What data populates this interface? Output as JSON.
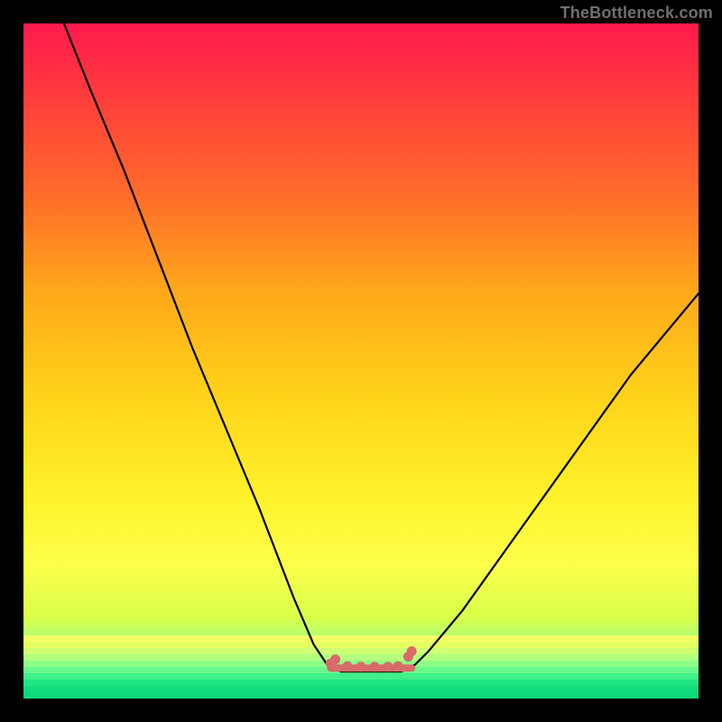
{
  "watermark": "TheBottleneck.com",
  "chart_data": {
    "type": "line",
    "title": "",
    "xlabel": "",
    "ylabel": "",
    "xlim": [
      0,
      100
    ],
    "ylim": [
      0,
      100
    ],
    "series": [
      {
        "name": "bottleneck-curve",
        "x": [
          6,
          10,
          15,
          20,
          25,
          30,
          35,
          40,
          43,
          45,
          47,
          48,
          50,
          52,
          54,
          56,
          58,
          60,
          65,
          70,
          75,
          80,
          85,
          90,
          95,
          100
        ],
        "y": [
          100,
          90,
          78,
          65,
          52,
          40,
          28,
          15,
          8,
          5,
          4,
          4,
          4,
          4,
          4,
          4,
          5,
          7,
          13,
          20,
          27,
          34,
          41,
          48,
          54,
          60
        ]
      }
    ],
    "highlight": {
      "name": "optimal-range",
      "x": [
        45.5,
        57.5
      ],
      "y": [
        4.5,
        4.5
      ],
      "points": [
        [
          45.5,
          5.2
        ],
        [
          46.2,
          5.8
        ],
        [
          48,
          4.8
        ],
        [
          50,
          4.7
        ],
        [
          52,
          4.7
        ],
        [
          54,
          4.7
        ],
        [
          55.5,
          4.8
        ],
        [
          57,
          6.2
        ],
        [
          57.5,
          7
        ]
      ],
      "color": "#d86a6a"
    }
  }
}
